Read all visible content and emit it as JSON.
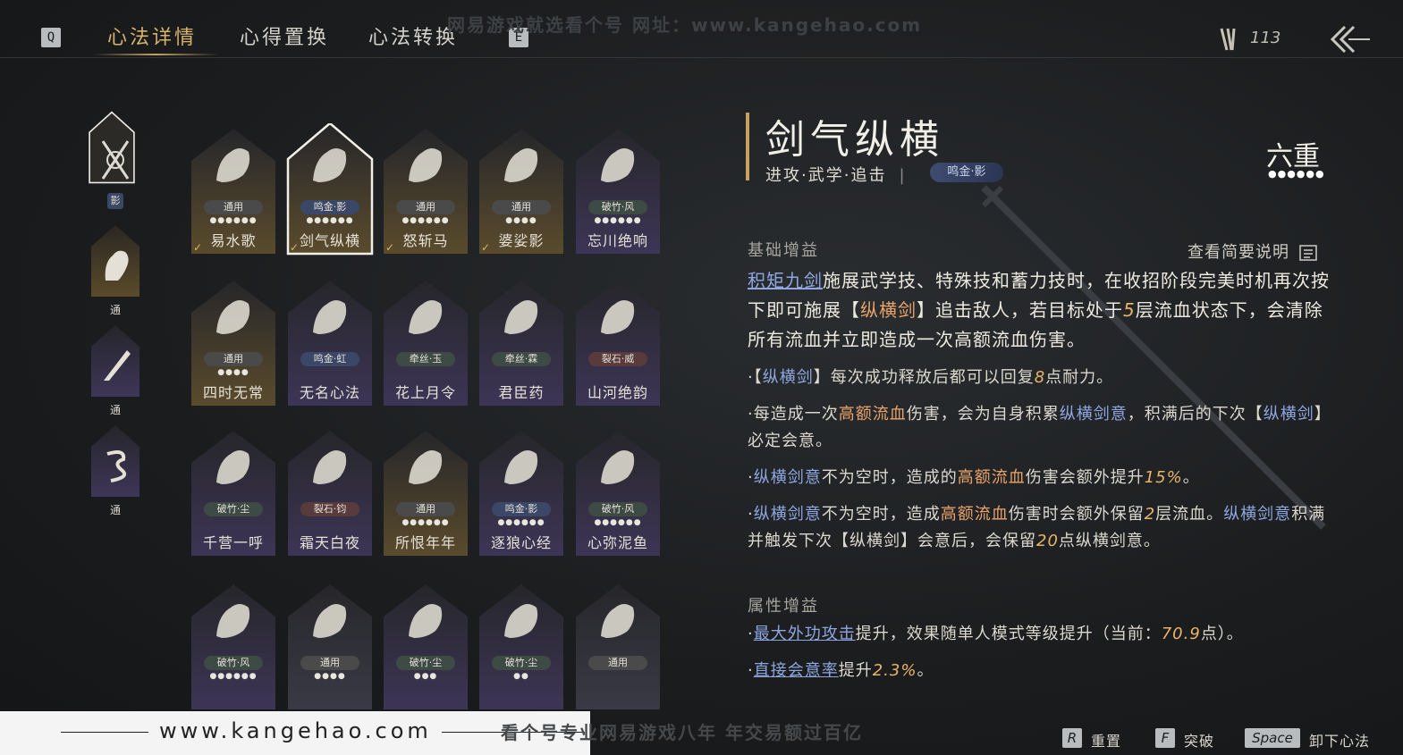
{
  "watermark_top": "网易游戏就选看个号  网址：www.kangehao.com",
  "topbar": {
    "key_left": "Q",
    "key_right": "E",
    "tabs": [
      "心法详情",
      "心得置换",
      "心法转换"
    ],
    "currency_value": "113"
  },
  "type_column": [
    {
      "label": "影",
      "icon": "crossed-swords-icon"
    },
    {
      "label": "通",
      "icon": "horse-icon"
    },
    {
      "label": "通",
      "icon": "blade-icon"
    },
    {
      "label": "通",
      "icon": "dragon-icon"
    }
  ],
  "cards": [
    {
      "name": "易水歌",
      "tag": "通用",
      "dots": "●●●●●●",
      "checked": true,
      "icon": "horse-icon"
    },
    {
      "name": "剑气纵横",
      "tag": "鸣金·影",
      "dots": "●●●●●●",
      "checked": true,
      "icon": "crossed-swords-icon"
    },
    {
      "name": "怒斩马",
      "tag": "通用",
      "dots": "●●●●●●",
      "checked": true,
      "icon": "blade-icon"
    },
    {
      "name": "婆娑影",
      "tag": "通用",
      "dots": "●●●●",
      "checked": true,
      "icon": "dragon-icon"
    },
    {
      "name": "忘川绝响",
      "tag": "破竹·风",
      "dots": "●●●●●●",
      "checked": false,
      "icon": "mask-icon"
    },
    {
      "name": "四时无常",
      "tag": "通用",
      "dots": "●●●●",
      "checked": false,
      "icon": "moon-icon"
    },
    {
      "name": "无名心法",
      "tag": "鸣金·虹",
      "dots": "",
      "checked": false,
      "icon": "sword-icon"
    },
    {
      "name": "花上月令",
      "tag": "牵丝·玉",
      "dots": "",
      "checked": false,
      "icon": "flower-icon"
    },
    {
      "name": "君臣药",
      "tag": "牵丝·霖",
      "dots": "",
      "checked": false,
      "icon": "herb-icon"
    },
    {
      "name": "山河绝韵",
      "tag": "裂石·威",
      "dots": "",
      "checked": false,
      "icon": "mountain-icon"
    },
    {
      "name": "千营一呼",
      "tag": "破竹·尘",
      "dots": "",
      "checked": false,
      "icon": "flag-icon"
    },
    {
      "name": "霜天白夜",
      "tag": "裂石·钧",
      "dots": "",
      "checked": false,
      "icon": "spear-icon"
    },
    {
      "name": "所恨年年",
      "tag": "通用",
      "dots": "●●●●●●",
      "checked": false,
      "icon": "reed-icon"
    },
    {
      "name": "逐狼心经",
      "tag": "鸣金·影",
      "dots": "●●●●●●",
      "checked": false,
      "icon": "wolf-icon"
    },
    {
      "name": "心弥泥鱼",
      "tag": "破竹·风",
      "dots": "●●●●●●",
      "checked": false,
      "icon": "fish-icon"
    },
    {
      "name": "",
      "tag": "破竹·风",
      "dots": "●●●●●●",
      "checked": false,
      "icon": "warrior-icon"
    },
    {
      "name": "",
      "tag": "通用",
      "dots": "●●●●",
      "checked": false,
      "icon": "bird-icon"
    },
    {
      "name": "",
      "tag": "破竹·尘",
      "dots": "●●●",
      "checked": false,
      "icon": "tree-icon"
    },
    {
      "name": "",
      "tag": "破竹·尘",
      "dots": "●●",
      "checked": false,
      "icon": "hand-icon"
    },
    {
      "name": "",
      "tag": "通用",
      "dots": "",
      "checked": false,
      "icon": "swallow-icon"
    }
  ],
  "detail": {
    "title": "剑气纵横",
    "subtitle": "进攻·武学·追击",
    "faction": "鸣金·影",
    "level": "六重",
    "level_dots": "●●●●●●",
    "basic_title": "基础增益",
    "summary_link": "查看简要说明",
    "attr_title": "属性增益",
    "p1": [
      "积矩九剑",
      "施展武学技、特殊技和蓄力技时，在收招阶段完美时机再次按下即可施展【",
      "纵横剑",
      "】追击敌人，若目标处于",
      "5",
      "层流血状态下，会清除所有流血并立即造成一次高额流血伤害。"
    ],
    "b1": [
      "·【",
      "纵横剑",
      "】每次成功释放后都可以回复",
      "8",
      "点耐力。"
    ],
    "b2": [
      "·每造成一次",
      "高额流血",
      "伤害，会为自身积累",
      "纵横剑意",
      "，积满后的下次【",
      "纵横剑",
      "】必定会意。"
    ],
    "b3": [
      "·",
      "纵横剑意",
      "不为空时，造成的",
      "高额流血",
      "伤害会额外提升",
      "15%",
      "。"
    ],
    "b4": [
      "·",
      "纵横剑意",
      "不为空时，造成",
      "高额流血",
      "伤害时会额外保留",
      "2",
      "层流血。",
      "纵横剑意",
      "积满并触发下次【纵横剑】会意后，会保留",
      "20",
      "点纵横剑意。"
    ],
    "a1": [
      "·",
      "最大外功攻击",
      "提升，效果随单人模式等级提升（当前：",
      "70.9",
      "点）。"
    ],
    "a2": [
      "·",
      "直接会意率",
      "提升",
      "2.3%",
      "。"
    ]
  },
  "bottom": {
    "site": "www.kangehao.com",
    "watermark": "看个号专业网易游戏八年  年交易额过百亿",
    "hints": [
      {
        "key": "R",
        "label": "重置"
      },
      {
        "key": "F",
        "label": "突破"
      },
      {
        "key": "Space",
        "label": "卸下心法"
      }
    ]
  }
}
